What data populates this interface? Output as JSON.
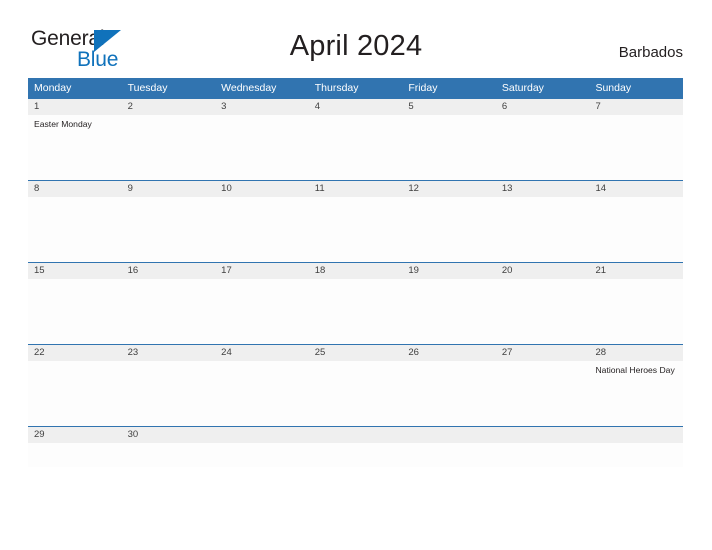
{
  "brand": {
    "name_part1": "General",
    "name_part2": "Blue",
    "flag_icon": "flag-triangle-icon",
    "flag_color": "#1072bb",
    "text_color": "#231f20"
  },
  "header": {
    "title": "April 2024",
    "country": "Barbados"
  },
  "theme": {
    "header_blue": "#3174b0",
    "day_number_bg": "#efefef",
    "cell_bg": "#fdfdfd",
    "accent_blue": "#1072bb"
  },
  "calendar": {
    "weekdays": [
      "Monday",
      "Tuesday",
      "Wednesday",
      "Thursday",
      "Friday",
      "Saturday",
      "Sunday"
    ],
    "weeks": [
      {
        "days": [
          {
            "number": "1",
            "events": [
              "Easter Monday"
            ]
          },
          {
            "number": "2",
            "events": []
          },
          {
            "number": "3",
            "events": []
          },
          {
            "number": "4",
            "events": []
          },
          {
            "number": "5",
            "events": []
          },
          {
            "number": "6",
            "events": []
          },
          {
            "number": "7",
            "events": []
          }
        ]
      },
      {
        "days": [
          {
            "number": "8",
            "events": []
          },
          {
            "number": "9",
            "events": []
          },
          {
            "number": "10",
            "events": []
          },
          {
            "number": "11",
            "events": []
          },
          {
            "number": "12",
            "events": []
          },
          {
            "number": "13",
            "events": []
          },
          {
            "number": "14",
            "events": []
          }
        ]
      },
      {
        "days": [
          {
            "number": "15",
            "events": []
          },
          {
            "number": "16",
            "events": []
          },
          {
            "number": "17",
            "events": []
          },
          {
            "number": "18",
            "events": []
          },
          {
            "number": "19",
            "events": []
          },
          {
            "number": "20",
            "events": []
          },
          {
            "number": "21",
            "events": []
          }
        ]
      },
      {
        "days": [
          {
            "number": "22",
            "events": []
          },
          {
            "number": "23",
            "events": []
          },
          {
            "number": "24",
            "events": []
          },
          {
            "number": "25",
            "events": []
          },
          {
            "number": "26",
            "events": []
          },
          {
            "number": "27",
            "events": []
          },
          {
            "number": "28",
            "events": [
              "National Heroes Day"
            ]
          }
        ]
      },
      {
        "days": [
          {
            "number": "29",
            "events": []
          },
          {
            "number": "30",
            "events": []
          },
          {
            "number": "",
            "events": []
          },
          {
            "number": "",
            "events": []
          },
          {
            "number": "",
            "events": []
          },
          {
            "number": "",
            "events": []
          },
          {
            "number": "",
            "events": []
          }
        ]
      }
    ]
  }
}
